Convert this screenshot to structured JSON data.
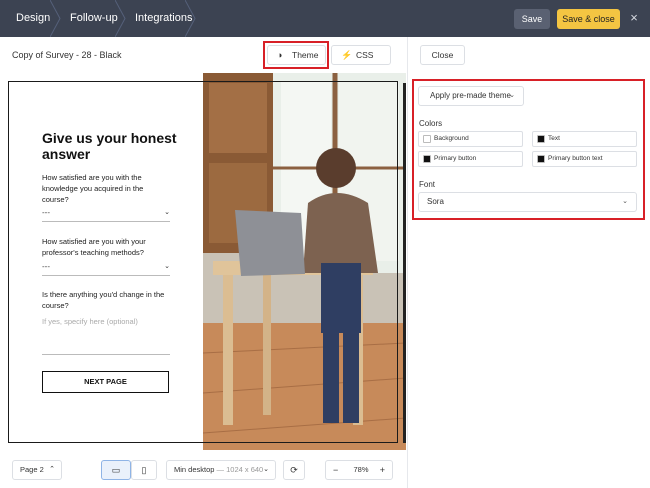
{
  "topbar": {
    "tabs": [
      "Design",
      "Follow-up",
      "Integrations"
    ],
    "save_label": "Save",
    "save_close_label": "Save & close",
    "close_glyph": "×"
  },
  "editor": {
    "document_title": "Copy of Survey - 28 - Black",
    "tab_theme": "Theme",
    "tab_css": "CSS",
    "icons": {
      "theme": "contrast-icon",
      "css": "lightning-icon"
    }
  },
  "panel": {
    "close_label": "Close",
    "premade_label": "Apply pre-made theme",
    "colors_label": "Colors",
    "colors": [
      {
        "label": "Background",
        "swatch": "#ffffff"
      },
      {
        "label": "Text",
        "swatch": "#111111"
      },
      {
        "label": "Primary button",
        "swatch": "#111111"
      },
      {
        "label": "Primary button text",
        "swatch": "#111111"
      }
    ],
    "font_label": "Font",
    "font_value": "Sora"
  },
  "survey": {
    "heading": "Give us your honest answer",
    "questions": [
      {
        "text": "How satisfied are you with the knowledge you acquired in the course?",
        "answer": "---"
      },
      {
        "text": "How satisfied are you with your professor's teaching methods?",
        "answer": "---"
      },
      {
        "text": "Is there anything you'd change in the course?",
        "placeholder": "If yes, specify here (optional)"
      }
    ],
    "next_button": "NEXT PAGE"
  },
  "bottombar": {
    "page_label": "Page 2",
    "resolution_label": "Min desktop",
    "resolution_value": "— 1024 x 640",
    "zoom_value": "78%",
    "zoom_minus": "−",
    "zoom_plus": "+"
  },
  "accent_colors": {
    "highlight": "#d82027",
    "save_close": "#f4c542",
    "topbar": "#3c4352"
  }
}
